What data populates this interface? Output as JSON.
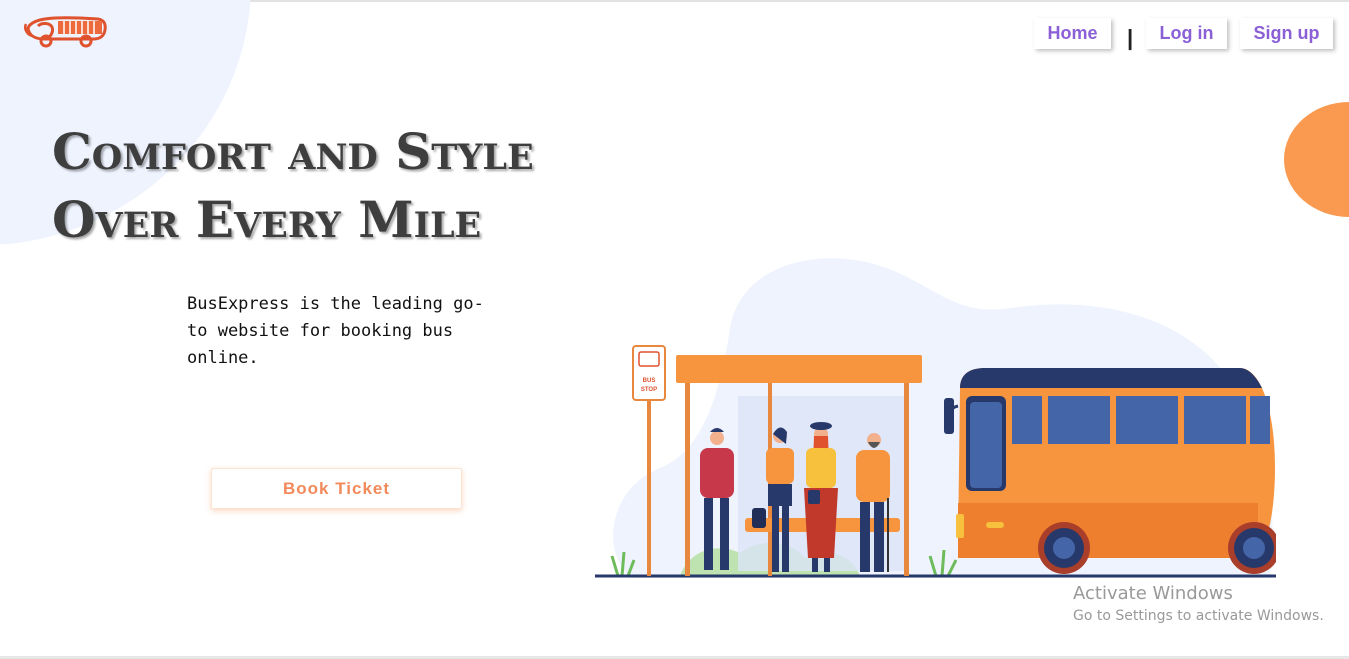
{
  "nav": {
    "home_label": "Home",
    "separator": "|",
    "login_label": "Log in",
    "signup_label": "Sign up"
  },
  "hero": {
    "headline_line1": "Comfort and Style",
    "headline_line2": "Over Every Mile",
    "tagline": "BusExpress is the leading go-to website for booking bus online.",
    "cta_label": "Book Ticket"
  },
  "illustration": {
    "sign_line1": "BUS",
    "sign_line2": "STOP"
  },
  "watermark": {
    "title": "Activate Windows",
    "subtitle": "Go to Settings to activate Windows."
  },
  "colors": {
    "nav_text": "#8b5fd6",
    "cta_text": "#f28a5b",
    "accent_orange": "#fa9a50",
    "bus_navy": "#27386a",
    "bg_blob": "#eef3fe"
  }
}
